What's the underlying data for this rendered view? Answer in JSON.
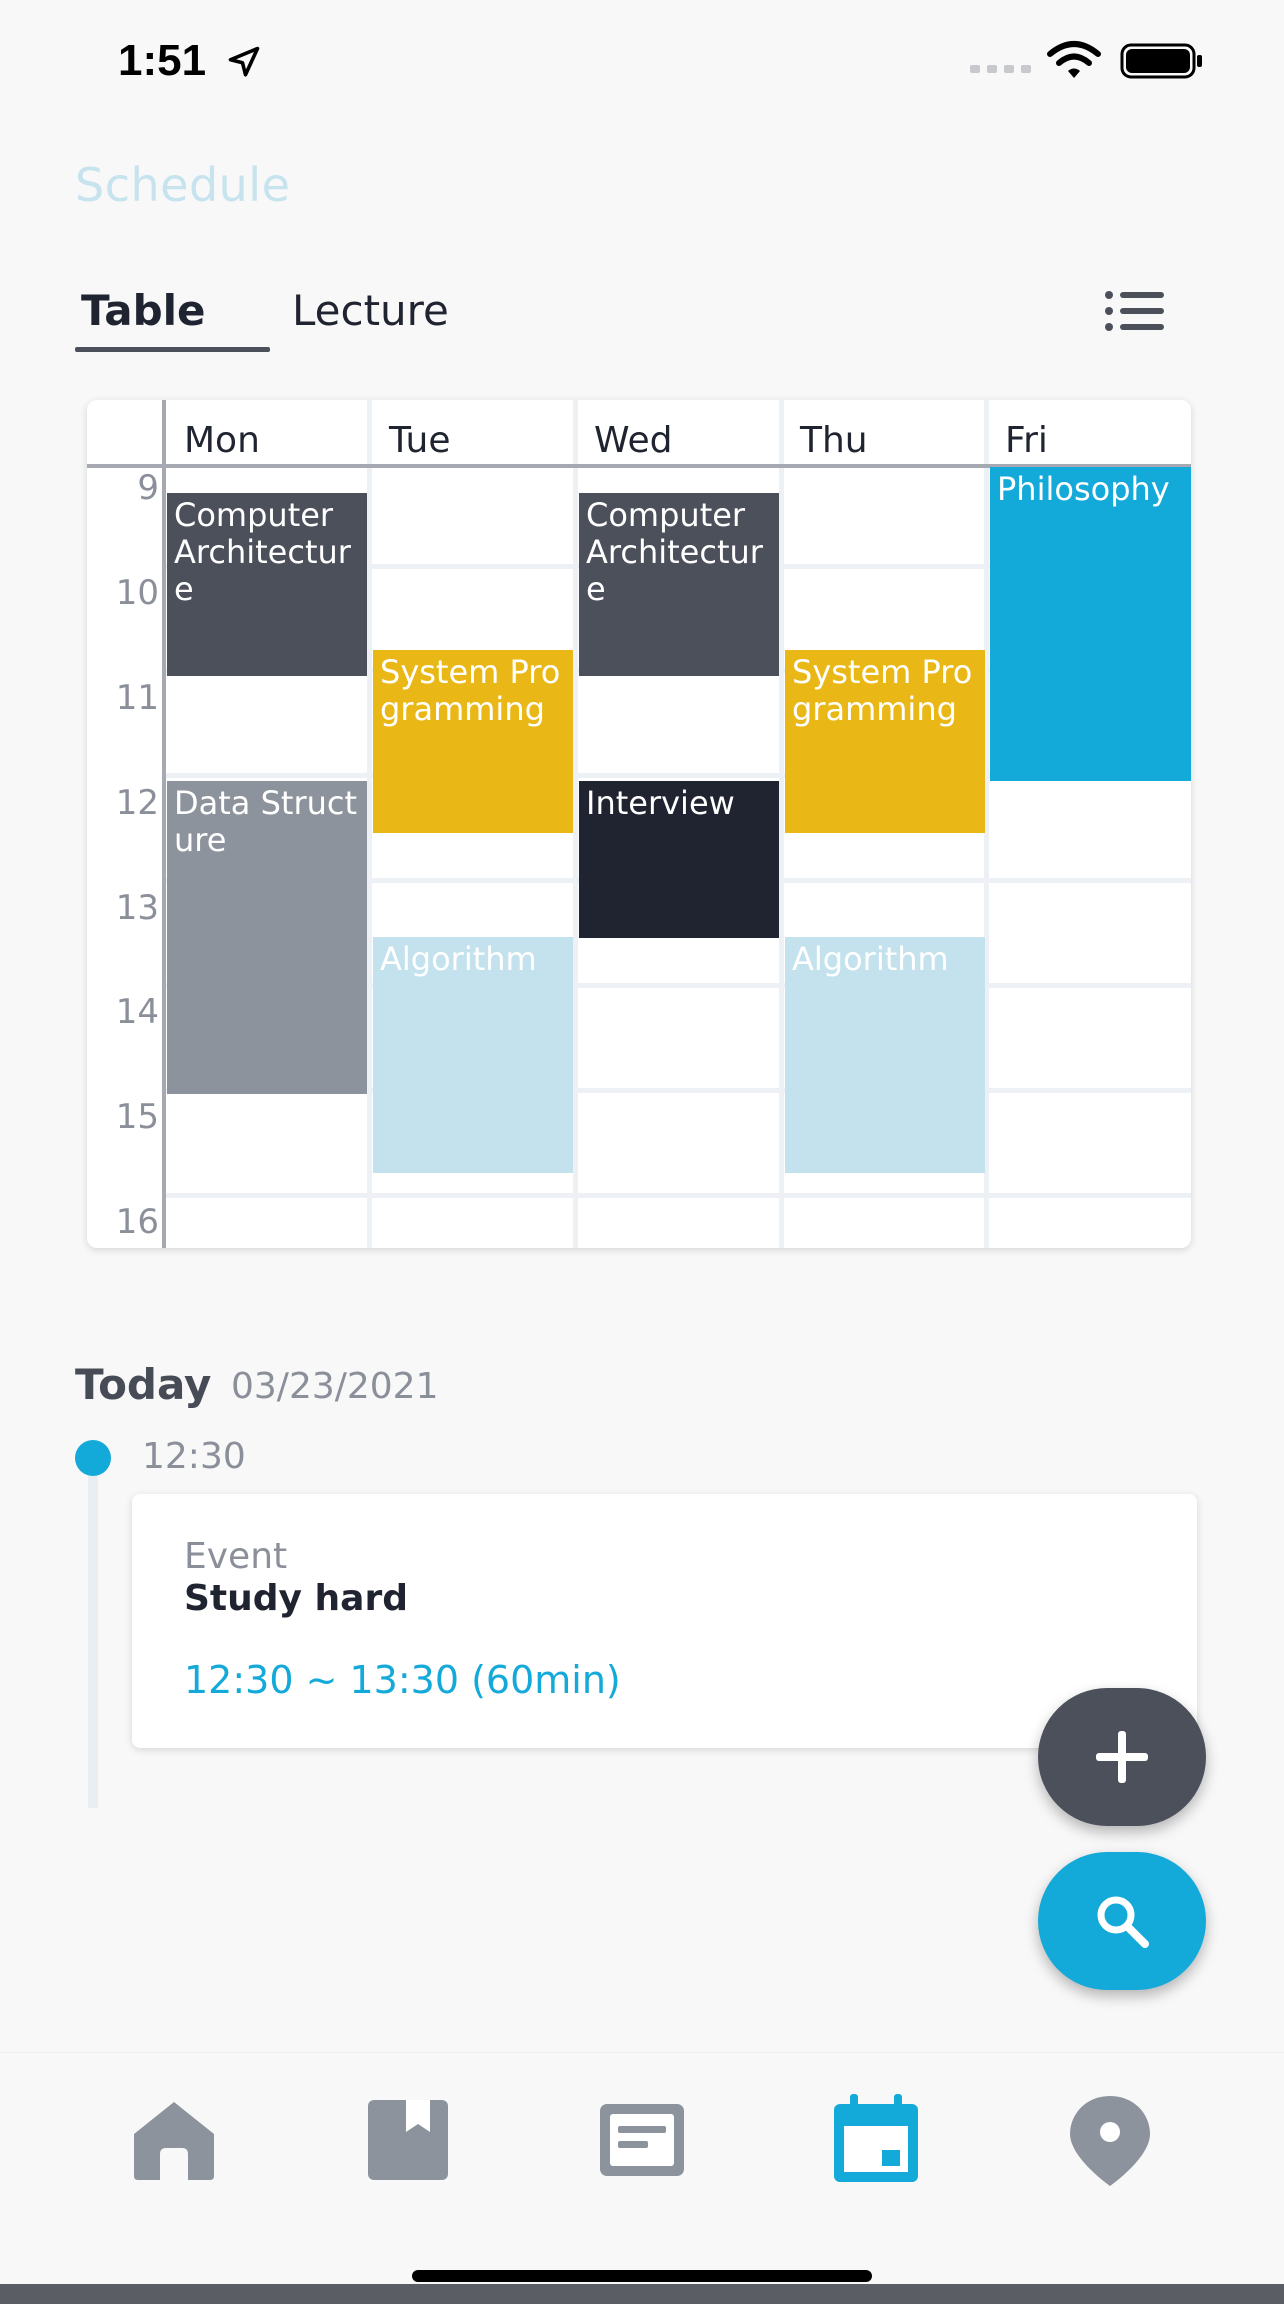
{
  "status_bar": {
    "time": "1:51"
  },
  "header": {
    "title": "Schedule"
  },
  "tabs": [
    {
      "label": "Table",
      "active": true
    },
    {
      "label": "Lecture",
      "active": false
    }
  ],
  "timetable": {
    "days": [
      "Mon",
      "Tue",
      "Wed",
      "Thu",
      "Fri"
    ],
    "hours": [
      "9",
      "10",
      "11",
      "12",
      "13",
      "14",
      "15",
      "16"
    ],
    "courses": [
      {
        "name": "Computer Architecture",
        "day": "Mon",
        "start": "9:15",
        "end": "11:00",
        "color": "#4b505b"
      },
      {
        "name": "Data Structure",
        "day": "Mon",
        "start": "12:00",
        "end": "15:00",
        "color": "#8d939c"
      },
      {
        "name": "System Programming",
        "day": "Tue",
        "start": "10:45",
        "end": "12:30",
        "color": "#e9b817"
      },
      {
        "name": "Algorithm",
        "day": "Tue",
        "start": "13:30",
        "end": "15:45",
        "color": "#c3e2ed"
      },
      {
        "name": "Computer Architecture",
        "day": "Wed",
        "start": "9:15",
        "end": "11:00",
        "color": "#4b505b"
      },
      {
        "name": "Interview",
        "day": "Wed",
        "start": "12:00",
        "end": "13:30",
        "color": "#1f2430"
      },
      {
        "name": "System Programming",
        "day": "Thu",
        "start": "10:45",
        "end": "12:30",
        "color": "#e9b817"
      },
      {
        "name": "Algorithm",
        "day": "Thu",
        "start": "13:30",
        "end": "15:45",
        "color": "#c3e2ed"
      },
      {
        "name": "Philosophy",
        "day": "Fri",
        "start": "9:00",
        "end": "12:00",
        "color": "#13a9d9"
      }
    ]
  },
  "today": {
    "label": "Today",
    "date": "03/23/2021",
    "events": [
      {
        "time": "12:30",
        "type": "Event",
        "title": "Study hard",
        "range": "12:30 ~ 13:30 (60min)"
      }
    ]
  },
  "fab": {
    "add_icon": "plus-icon",
    "search_icon": "search-icon"
  },
  "bottom_nav": [
    {
      "icon": "home-icon",
      "active": false
    },
    {
      "icon": "bookmark-book-icon",
      "active": false
    },
    {
      "icon": "notes-icon",
      "active": false
    },
    {
      "icon": "calendar-icon",
      "active": true
    },
    {
      "icon": "location-pin-icon",
      "active": false
    }
  ],
  "colors": {
    "accent": "#13a9d9",
    "dark": "#4b505b",
    "inactive_icon": "#8d939c"
  }
}
